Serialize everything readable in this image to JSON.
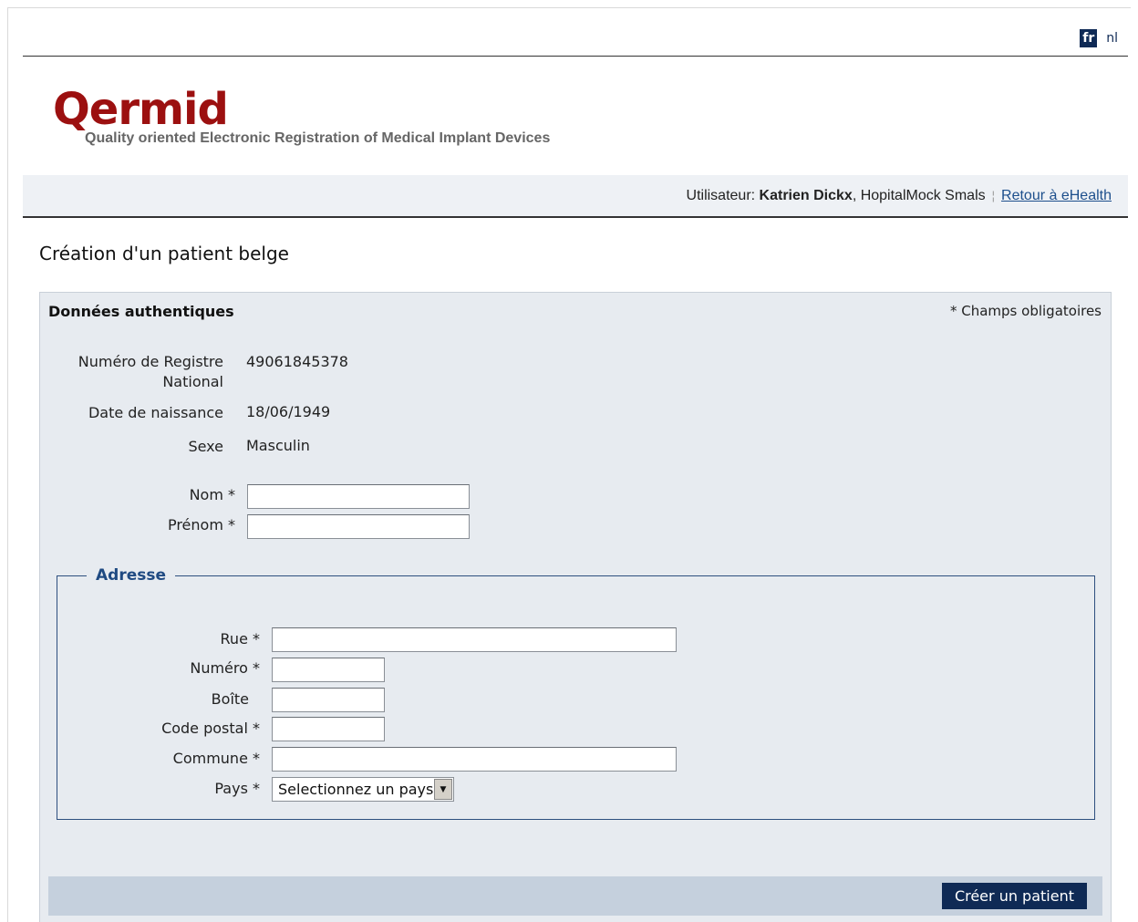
{
  "language": {
    "fr": "fr",
    "nl": "nl"
  },
  "logo": {
    "word": "Qermid",
    "subtitle": "Quality oriented Electronic Registration of Medical Implant Devices"
  },
  "userbar": {
    "label": "Utilisateur:",
    "name": "Katrien Dickx",
    "org": ", HopitalMock Smals",
    "separator": "¦",
    "link": "Retour à eHealth"
  },
  "page": {
    "title": "Création d'un patient belge"
  },
  "panel": {
    "title": "Données authentiques",
    "required_note": "* Champs obligatoires",
    "fields": {
      "nrn_label_1": "Numéro de Registre",
      "nrn_label_2": "National",
      "nrn_value": "49061845378",
      "dob_label": "Date de naissance",
      "dob_value": "18/06/1949",
      "sex_label": "Sexe",
      "sex_value": "Masculin",
      "nom_label": "Nom *",
      "prenom_label": "Prénom *"
    }
  },
  "address": {
    "legend": "Adresse",
    "rue_label": "Rue *",
    "numero_label": "Numéro *",
    "boite_label": "Boîte",
    "code_postal_label": "Code postal *",
    "commune_label": "Commune *",
    "pays_label": "Pays *",
    "pays_selected": "Selectionnez un pays"
  },
  "actions": {
    "create": "Créer un patient"
  },
  "colors": {
    "brand_red": "#9c1010",
    "navy": "#0f2a55",
    "panel_bg": "#e7ebf0",
    "legend_blue": "#1f4a82"
  }
}
